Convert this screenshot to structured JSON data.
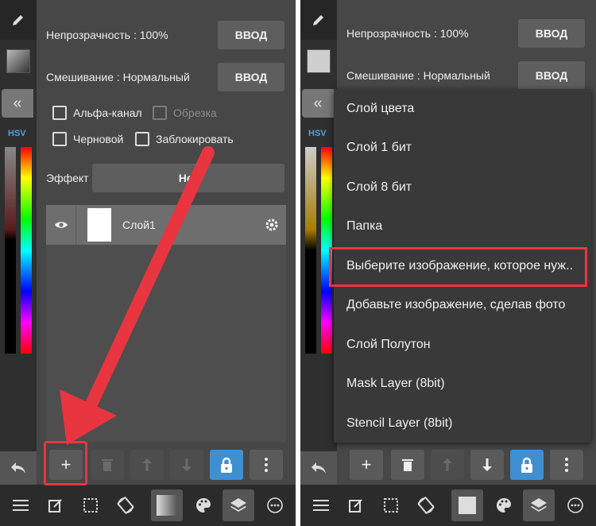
{
  "panel": {
    "opacity_label": "Непрозрачность : 100%",
    "blend_label": "Смешивание : Нормальный",
    "enter_button": "ВВОД",
    "alpha_label": "Альфа-канал",
    "clip_label": "Обрезка",
    "draft_label": "Черновой",
    "lock_label": "Заблокировать",
    "effect_label": "Эффект",
    "effect_value": "Нет",
    "hsv_label": "HSV"
  },
  "layers": [
    {
      "name": "Слой1"
    }
  ],
  "menu": {
    "items": [
      "Слой цвета",
      "Слой 1 бит",
      "Слой 8 бит",
      "Папка",
      "Выберите изображение, которое нуж..",
      "Добавьте изображение, сделав фото",
      "Слой Полутон",
      "Mask Layer (8bit)",
      "Stencil Layer (8bit)"
    ],
    "highlighted_index": 4
  },
  "colors": {
    "accent_blue": "#3f8fd1",
    "highlight_red": "#e8353f",
    "panel_bg": "#474747"
  },
  "icons": {
    "layer_toolbar": [
      "plus-icon",
      "trash-icon",
      "arrow-up-icon",
      "arrow-down-icon",
      "lock-icon",
      "more-vertical-icon"
    ],
    "bottom_bar": [
      "menu-icon",
      "edit-icon",
      "selection-icon",
      "rotate-icon",
      "gradient-swatch-icon",
      "palette-icon",
      "layers-icon",
      "dots-circle-icon"
    ]
  }
}
